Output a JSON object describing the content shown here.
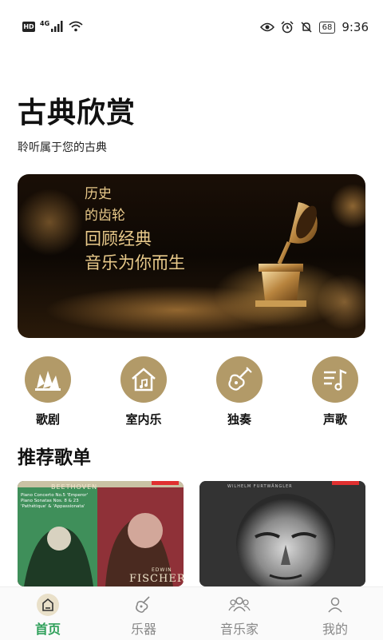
{
  "status_bar": {
    "hd": "HD",
    "network": "4G",
    "battery": "68",
    "time": "9:36"
  },
  "header": {
    "title": "古典欣赏",
    "subtitle": "聆听属于您的古典"
  },
  "banner": {
    "lines": [
      "历史",
      "的齿轮",
      "回顾经典",
      "音乐为你而生"
    ],
    "text_color": "#e8c98a"
  },
  "categories": [
    {
      "label": "歌剧",
      "icon": "opera-house-icon"
    },
    {
      "label": "室内乐",
      "icon": "house-music-icon"
    },
    {
      "label": "独奏",
      "icon": "guitar-icon"
    },
    {
      "label": "声歌",
      "icon": "music-list-icon"
    }
  ],
  "recommended": {
    "title": "推荐歌单",
    "playlists": [
      {
        "composer": "BEETHOVEN",
        "line1": "Piano Concerto No.5 'Emperor'",
        "line2": "Piano Sonatas Nos. 8 & 23",
        "line3": "'Pathétique' & 'Appassionata'",
        "performer_first": "EDWIN",
        "performer_last": "FISCHER"
      },
      {
        "header": "WILHELM FURTWÄNGLER"
      }
    ]
  },
  "tab_bar": {
    "tabs": [
      {
        "label": "首页",
        "icon": "home-icon",
        "active": true
      },
      {
        "label": "乐器",
        "icon": "instrument-icon",
        "active": false
      },
      {
        "label": "音乐家",
        "icon": "musicians-icon",
        "active": false
      },
      {
        "label": "我的",
        "icon": "profile-icon",
        "active": false
      }
    ],
    "active_color": "#2fa05a",
    "inactive_color": "#888888"
  },
  "colors": {
    "category_gold": "#b29a68",
    "accent_green": "#2fa05a"
  }
}
